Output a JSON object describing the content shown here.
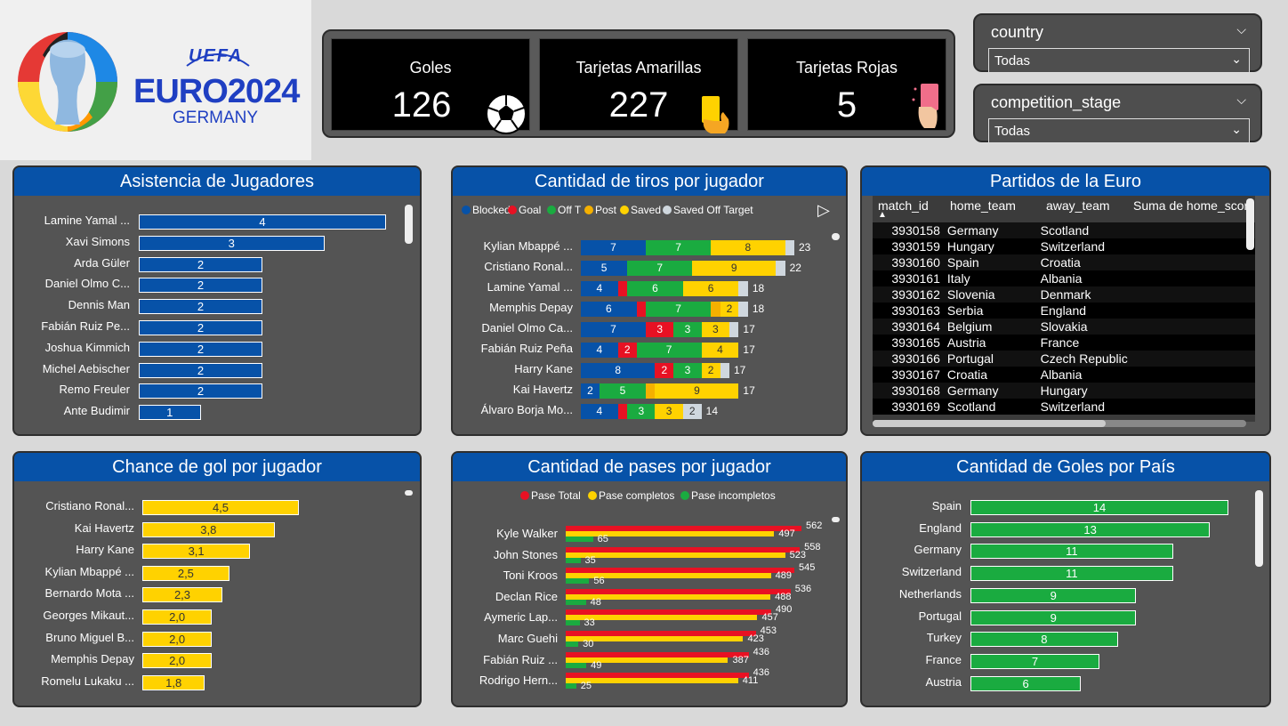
{
  "logo": {
    "uefa": "UEFA",
    "euro": "EURO2024",
    "country": "GERMANY"
  },
  "kpis": [
    {
      "title": "Goles",
      "value": "126",
      "icon": "soccer-ball-icon"
    },
    {
      "title": "Tarjetas Amarillas",
      "value": "227",
      "icon": "yellow-card-icon"
    },
    {
      "title": "Tarjetas Rojas",
      "value": "5",
      "icon": "red-card-icon"
    }
  ],
  "slicers": [
    {
      "title": "country",
      "selected": "Todas"
    },
    {
      "title": "competition_stage",
      "selected": "Todas"
    }
  ],
  "colors": {
    "blue": "#0752a8",
    "red": "#e81123",
    "green": "#1aab40",
    "yellow": "#ffd200",
    "orange": "#f5b000",
    "lightgray": "#cfd7de"
  },
  "assists": {
    "title": "Asistencia de Jugadores",
    "chart_data": {
      "type": "bar",
      "orientation": "horizontal",
      "categories": [
        "Lamine Yamal ...",
        "Xavi Simons",
        "Arda Güler",
        "Daniel Olmo C...",
        "Dennis Man",
        "Fabián Ruiz Pe...",
        "Joshua Kimmich",
        "Michel Aebischer",
        "Remo Freuler",
        "Ante Budimir"
      ],
      "values": [
        4,
        3,
        2,
        2,
        2,
        2,
        2,
        2,
        2,
        1
      ],
      "xlim": [
        0,
        4
      ]
    }
  },
  "shots": {
    "title": "Cantidad de tiros por jugador",
    "legend": [
      "Blocked",
      "Goal",
      "Off T",
      "Post",
      "Saved",
      "Saved Off Target"
    ],
    "chart_data": {
      "type": "bar",
      "stacked": true,
      "orientation": "horizontal",
      "categories": [
        "Kylian Mbappé ...",
        "Cristiano Ronal...",
        "Lamine Yamal ...",
        "Memphis Depay",
        "Daniel Olmo Ca...",
        "Fabián Ruiz Peña",
        "Harry Kane",
        "Kai Havertz",
        "Álvaro Borja Mo..."
      ],
      "series": [
        {
          "name": "Blocked",
          "values": [
            7,
            5,
            4,
            6,
            7,
            4,
            8,
            2,
            4
          ]
        },
        {
          "name": "Goal",
          "values": [
            0,
            0,
            1,
            1,
            3,
            2,
            2,
            0,
            1
          ]
        },
        {
          "name": "Off T",
          "values": [
            7,
            7,
            6,
            7,
            3,
            7,
            3,
            5,
            3
          ]
        },
        {
          "name": "Post",
          "values": [
            0,
            0,
            0,
            1,
            0,
            0,
            0,
            1,
            0
          ]
        },
        {
          "name": "Saved",
          "values": [
            8,
            9,
            6,
            2,
            3,
            4,
            2,
            9,
            3
          ]
        },
        {
          "name": "Saved Off Target",
          "values": [
            1,
            1,
            1,
            1,
            1,
            0,
            1,
            0,
            2
          ]
        }
      ],
      "totals": [
        23,
        22,
        18,
        18,
        17,
        17,
        17,
        17,
        14
      ],
      "xlim": [
        0,
        23
      ]
    }
  },
  "matches": {
    "title": "Partidos de la Euro",
    "columns": [
      "match_id",
      "home_team",
      "away_team",
      "Suma de home_scor"
    ],
    "rows": [
      [
        "3930158",
        "Germany",
        "Scotland"
      ],
      [
        "3930159",
        "Hungary",
        "Switzerland"
      ],
      [
        "3930160",
        "Spain",
        "Croatia"
      ],
      [
        "3930161",
        "Italy",
        "Albania"
      ],
      [
        "3930162",
        "Slovenia",
        "Denmark"
      ],
      [
        "3930163",
        "Serbia",
        "England"
      ],
      [
        "3930164",
        "Belgium",
        "Slovakia"
      ],
      [
        "3930165",
        "Austria",
        "France"
      ],
      [
        "3930166",
        "Portugal",
        "Czech Republic"
      ],
      [
        "3930167",
        "Croatia",
        "Albania"
      ],
      [
        "3930168",
        "Germany",
        "Hungary"
      ],
      [
        "3930169",
        "Scotland",
        "Switzerland"
      ]
    ]
  },
  "chances": {
    "title": "Chance de gol por jugador",
    "chart_data": {
      "type": "bar",
      "orientation": "horizontal",
      "categories": [
        "Cristiano Ronal...",
        "Kai Havertz",
        "Harry Kane",
        "Kylian Mbappé ...",
        "Bernardo Mota ...",
        "Georges Mikaut...",
        "Bruno Miguel B...",
        "Memphis Depay",
        "Romelu Lukaku ..."
      ],
      "values": [
        4.5,
        3.8,
        3.1,
        2.5,
        2.3,
        2.0,
        2.0,
        2.0,
        1.8
      ],
      "labels": [
        "4,5",
        "3,8",
        "3,1",
        "2,5",
        "2,3",
        "2,0",
        "2,0",
        "2,0",
        "1,8"
      ],
      "xlim": [
        0,
        4.5
      ]
    }
  },
  "passes": {
    "title": "Cantidad de pases por jugador",
    "legend": [
      "Pase Total",
      "Pase completos",
      "Pase incompletos"
    ],
    "chart_data": {
      "type": "bar",
      "orientation": "horizontal",
      "categories": [
        "Kyle Walker",
        "John Stones",
        "Toni Kroos",
        "Declan Rice",
        "Aymeric Lap...",
        "Marc Guehi",
        "Fabián Ruiz ...",
        "Rodrigo Hern..."
      ],
      "series": [
        {
          "name": "Pase Total",
          "values": [
            562,
            558,
            545,
            536,
            490,
            453,
            436,
            436
          ]
        },
        {
          "name": "Pase completos",
          "values": [
            497,
            523,
            489,
            488,
            457,
            423,
            387,
            411
          ]
        },
        {
          "name": "Pase incompletos",
          "values": [
            65,
            35,
            56,
            48,
            33,
            30,
            49,
            25
          ]
        }
      ],
      "xlim": [
        0,
        562
      ]
    }
  },
  "goals_country": {
    "title": "Cantidad de Goles por País",
    "chart_data": {
      "type": "bar",
      "orientation": "horizontal",
      "categories": [
        "Spain",
        "England",
        "Germany",
        "Switzerland",
        "Netherlands",
        "Portugal",
        "Turkey",
        "France",
        "Austria"
      ],
      "values": [
        14,
        13,
        11,
        11,
        9,
        9,
        8,
        7,
        6
      ],
      "xlim": [
        0,
        14
      ]
    }
  }
}
